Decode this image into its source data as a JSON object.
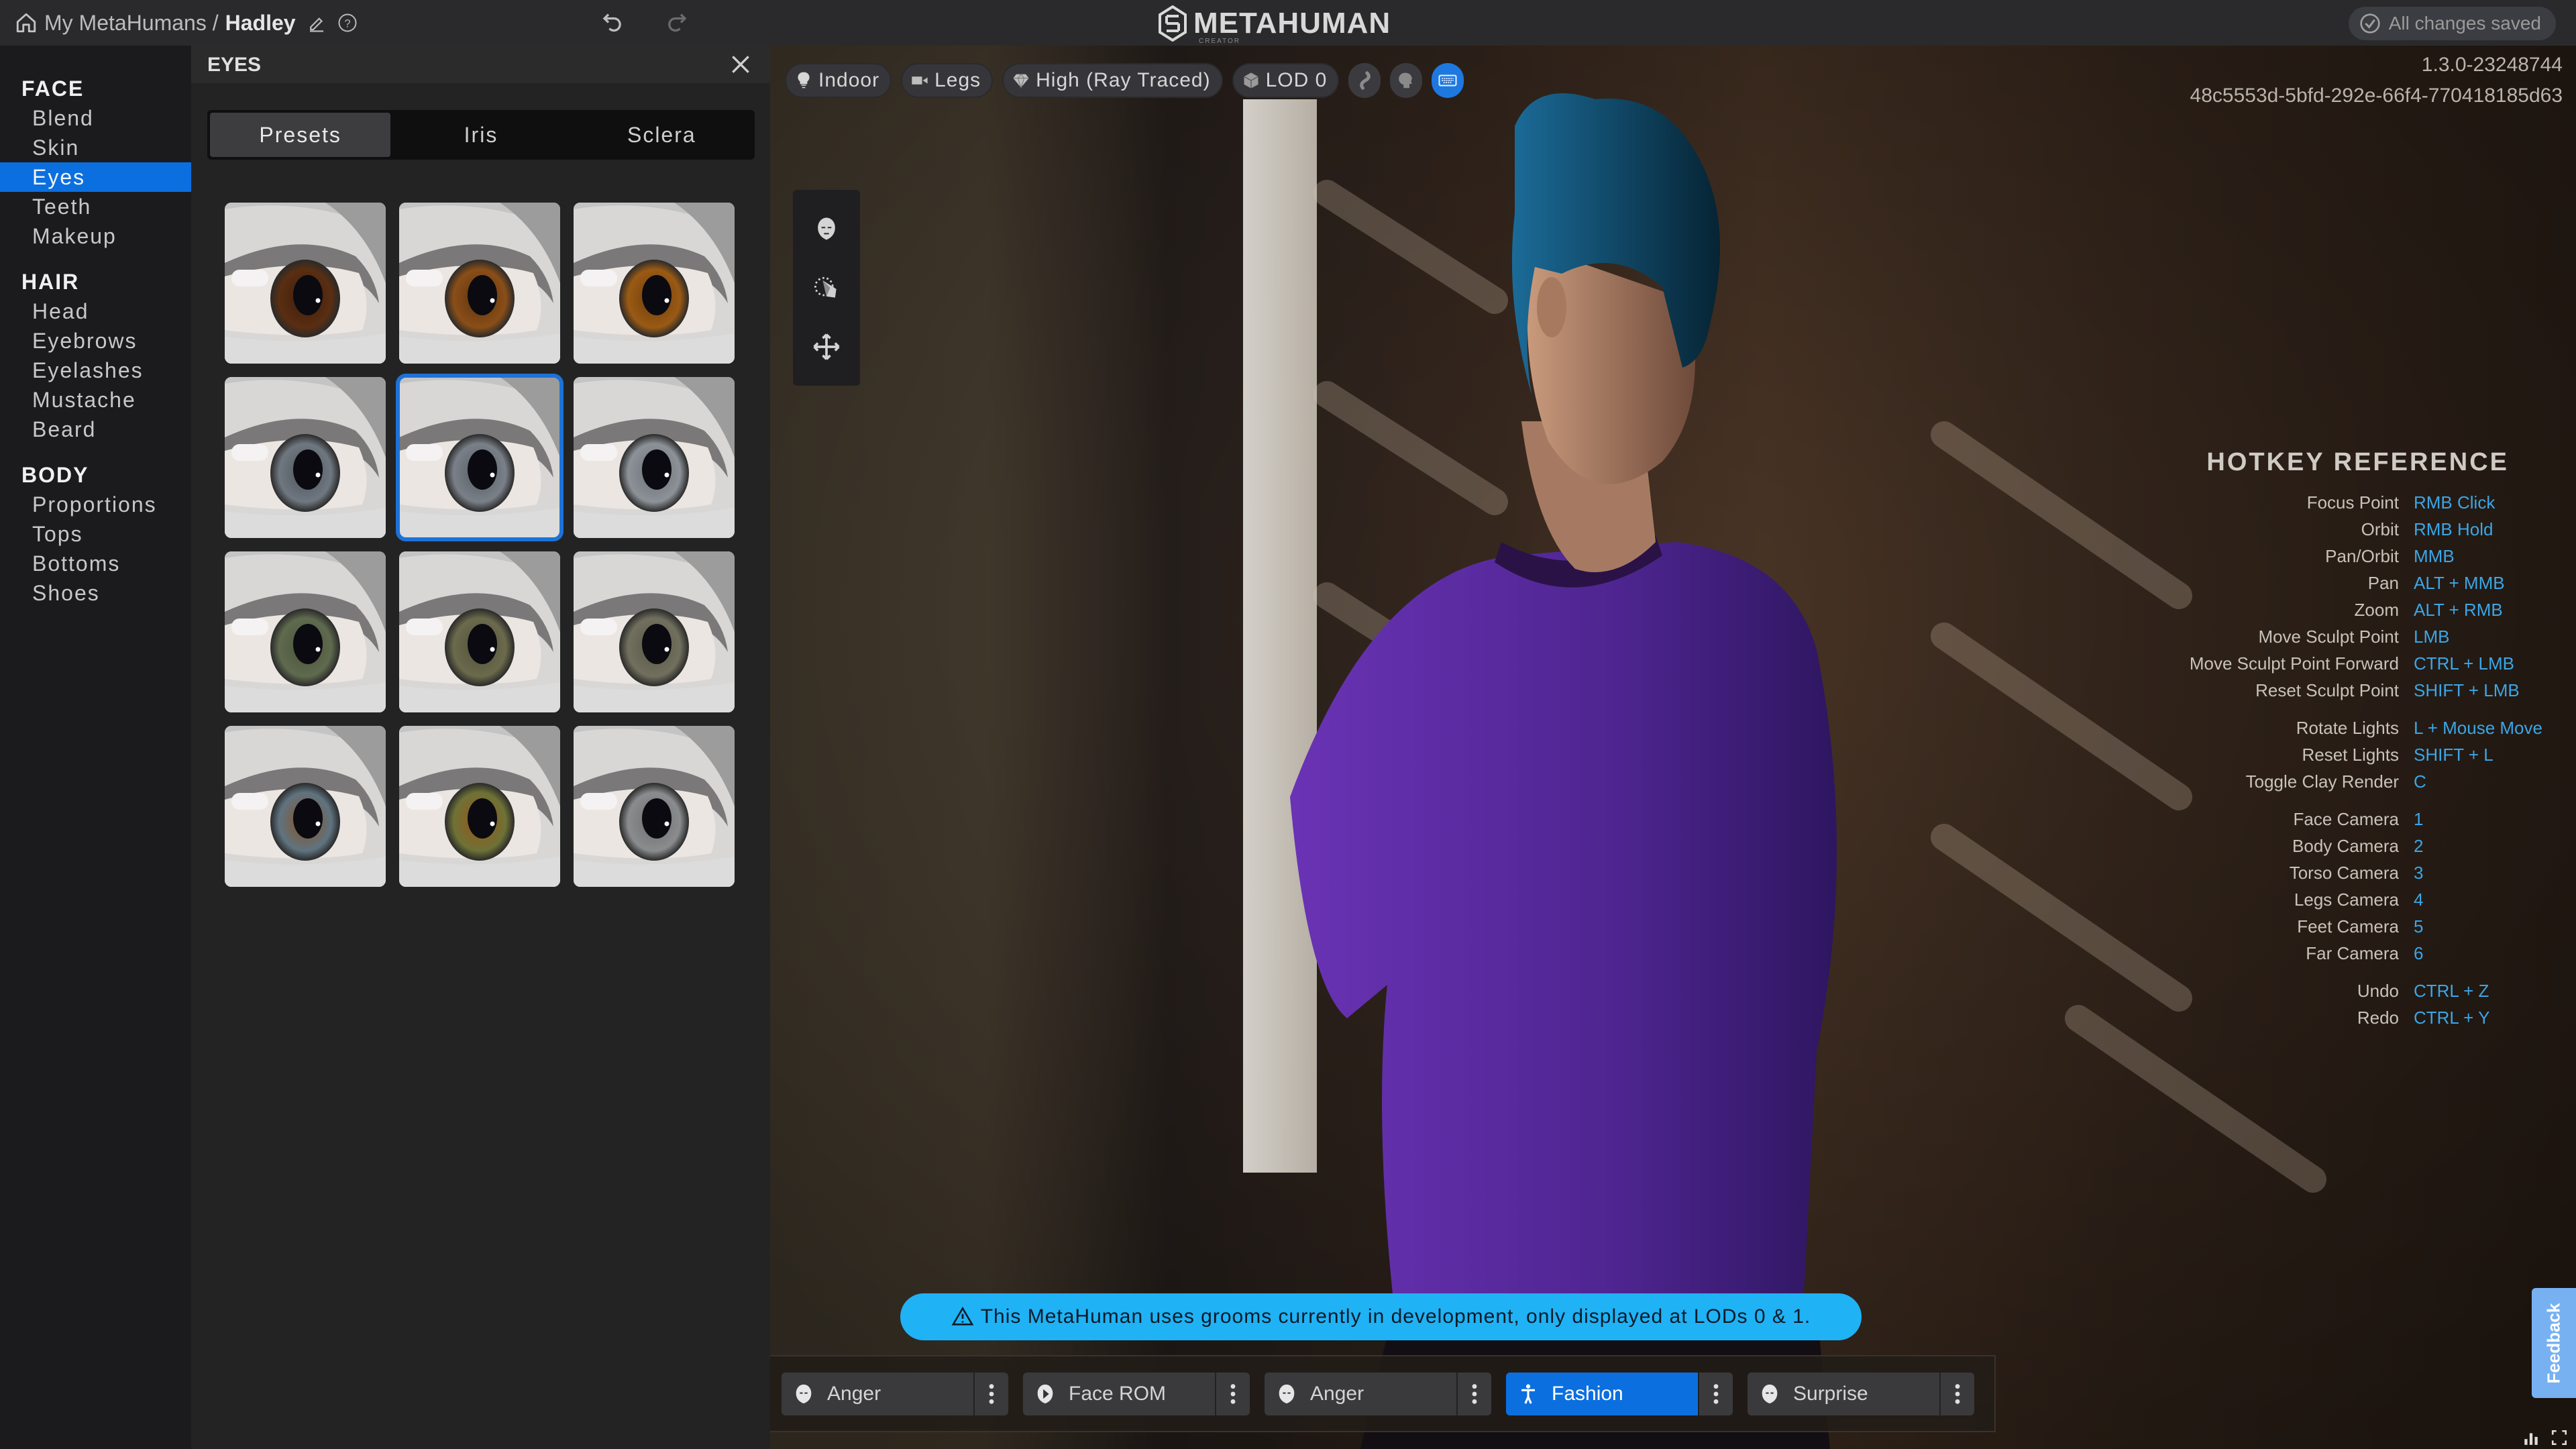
{
  "topbar": {
    "breadcrumb_root": "My MetaHumans /",
    "character_name": "Hadley",
    "logo_text": "METAHUMAN",
    "logo_sub": "CREATOR",
    "save_status": "All changes saved",
    "icons": [
      "home-icon",
      "edit-icon",
      "help-icon",
      "undo-icon",
      "redo-icon",
      "check-circle-icon"
    ]
  },
  "nav": {
    "sections": [
      {
        "title": "FACE",
        "items": [
          "Blend",
          "Skin",
          "Eyes",
          "Teeth",
          "Makeup"
        ]
      },
      {
        "title": "HAIR",
        "items": [
          "Head",
          "Eyebrows",
          "Eyelashes",
          "Mustache",
          "Beard"
        ]
      },
      {
        "title": "BODY",
        "items": [
          "Proportions",
          "Tops",
          "Bottoms",
          "Shoes"
        ]
      }
    ],
    "active_item": "Eyes"
  },
  "panel": {
    "title": "EYES",
    "tabs": [
      "Presets",
      "Iris",
      "Sclera"
    ],
    "active_tab": "Presets",
    "presets": [
      {
        "iris": "#5a2e12",
        "iris_inner": "#3c1e0c"
      },
      {
        "iris": "#8a4e18",
        "iris_inner": "#5c3210"
      },
      {
        "iris": "#9a5a14",
        "iris_inner": "#6e3c0c"
      },
      {
        "iris": "#6f7780",
        "iris_inner": "#4d545c"
      },
      {
        "iris": "#7a8088",
        "iris_inner": "#565c64"
      },
      {
        "iris": "#8c9298",
        "iris_inner": "#6a7076"
      },
      {
        "iris": "#5f6a4e",
        "iris_inner": "#48523a"
      },
      {
        "iris": "#6b6a4c",
        "iris_inner": "#52503a"
      },
      {
        "iris": "#71705e",
        "iris_inner": "#585646"
      },
      {
        "iris": "#5f7480",
        "iris_inner": "#8a5020"
      },
      {
        "iris": "#6e7236",
        "iris_inner": "#9a5418"
      },
      {
        "iris": "#8a8c8e",
        "iris_inner": "#6c6e70"
      }
    ],
    "selected_preset": 4
  },
  "viewport": {
    "toolbar": [
      {
        "icon": "lightbulb-icon",
        "label": "Indoor"
      },
      {
        "icon": "camera-icon",
        "label": "Legs"
      },
      {
        "icon": "diamond-icon",
        "label": "High (Ray Traced)"
      },
      {
        "icon": "cube-icon",
        "label": "LOD 0"
      }
    ],
    "toggles": [
      "dna-icon",
      "head-silhouette-icon",
      "keyboard-icon"
    ],
    "active_toggle": "keyboard-icon",
    "version": "1.3.0-23248744",
    "guid": "48c5553d-5bfd-292e-66f4-770418185d63",
    "side_tools": [
      "face-icon",
      "rotate-light-icon",
      "move-icon"
    ],
    "hotkeys": {
      "title": "HOTKEY REFERENCE",
      "groups": [
        [
          {
            "action": "Focus Point",
            "key": "RMB Click"
          },
          {
            "action": "Orbit",
            "key": "RMB Hold"
          },
          {
            "action": "Pan/Orbit",
            "key": "MMB"
          },
          {
            "action": "Pan",
            "key": "ALT + MMB"
          },
          {
            "action": "Zoom",
            "key": "ALT + RMB"
          },
          {
            "action": "Move Sculpt Point",
            "key": "LMB"
          },
          {
            "action": "Move Sculpt Point Forward",
            "key": "CTRL + LMB"
          },
          {
            "action": "Reset Sculpt Point",
            "key": "SHIFT + LMB"
          }
        ],
        [
          {
            "action": "Rotate Lights",
            "key": "L + Mouse Move"
          },
          {
            "action": "Reset Lights",
            "key": "SHIFT + L"
          },
          {
            "action": "Toggle Clay Render",
            "key": "C"
          }
        ],
        [
          {
            "action": "Face Camera",
            "key": "1"
          },
          {
            "action": "Body Camera",
            "key": "2"
          },
          {
            "action": "Torso Camera",
            "key": "3"
          },
          {
            "action": "Legs Camera",
            "key": "4"
          },
          {
            "action": "Feet Camera",
            "key": "5"
          },
          {
            "action": "Far Camera",
            "key": "6"
          }
        ],
        [
          {
            "action": "Undo",
            "key": "CTRL + Z"
          },
          {
            "action": "Redo",
            "key": "CTRL + Y"
          }
        ]
      ]
    },
    "banner": "This MetaHuman uses grooms currently in development, only displayed at LODs 0 & 1.",
    "animations": [
      {
        "icon": "face-icon",
        "label": "Anger"
      },
      {
        "icon": "play-icon",
        "label": "Face ROM"
      },
      {
        "icon": "face-icon",
        "label": "Anger"
      },
      {
        "icon": "figure-icon",
        "label": "Fashion",
        "active": true
      },
      {
        "icon": "face-icon",
        "label": "Surprise"
      }
    ],
    "feedback": "Feedback",
    "colors": {
      "accent": "#0b6fe0",
      "banner": "#1fb2f5",
      "hotkey_key": "#3aa6e8",
      "shirt": "#5a2a9c",
      "hair": "#0f4a6e"
    }
  }
}
